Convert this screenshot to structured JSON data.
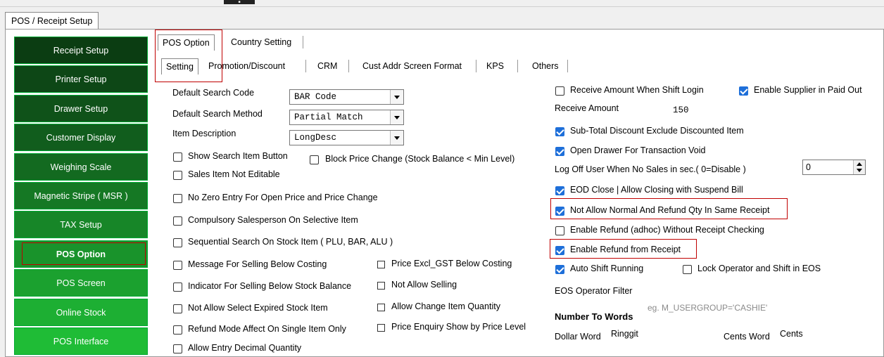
{
  "window": {
    "tab_label": "POS / Receipt Setup"
  },
  "sidebar": {
    "items": [
      {
        "label": "Receipt Setup",
        "color": "#0b3d12"
      },
      {
        "label": "Printer Setup",
        "color": "#0d4716"
      },
      {
        "label": "Drawer Setup",
        "color": "#0f5219"
      },
      {
        "label": "Customer Display",
        "color": "#115d1d"
      },
      {
        "label": "Weighing Scale",
        "color": "#136a20"
      },
      {
        "label": "Magnetic Stripe ( MSR )",
        "color": "#157824"
      },
      {
        "label": "TAX Setup",
        "color": "#178628"
      },
      {
        "label": "POS Option",
        "color": "#19932b",
        "active": true
      },
      {
        "label": "POS Screen",
        "color": "#1ba12f"
      },
      {
        "label": "Online Stock",
        "color": "#1daf33"
      },
      {
        "label": "POS Interface",
        "color": "#1fbc36"
      }
    ]
  },
  "tabs": {
    "top": [
      "POS Option",
      "Country Setting"
    ],
    "sub": [
      "Setting",
      "Promotion/Discount",
      "CRM",
      "Cust Addr Screen Format",
      "KPS",
      "Others"
    ]
  },
  "left": {
    "default_search_code_label": "Default Search Code",
    "default_search_code_value": "BAR Code",
    "default_search_method_label": "Default Search Method",
    "default_search_method_value": "Partial Match",
    "item_description_label": "Item Description",
    "item_description_value": "LongDesc",
    "checkboxes": [
      "Show Search Item Button",
      "Block Price Change (Stock Balance < Min Level)",
      "Sales Item Not Editable",
      "No Zero Entry For Open Price and Price Change",
      "Compulsory Salesperson On Selective Item",
      "Sequential Search On Stock Item ( PLU, BAR, ALU )",
      "Message For Selling Below Costing",
      "Price Excl_GST Below Costing",
      "Indicator For Selling Below Stock Balance",
      "Not Allow Selling",
      "Not Allow Select Expired Stock Item",
      "Allow Change Item Quantity",
      "Refund Mode Affect On Single Item Only",
      "Price Enquiry Show by Price Level",
      "Allow Entry Decimal Quantity"
    ]
  },
  "right": {
    "receive_amount_when_shift_login": "Receive Amount When Shift Login",
    "enable_supplier_in_paid_out": "Enable Supplier in Paid Out",
    "receive_amount_label": "Receive Amount",
    "receive_amount_value": "150",
    "subtotal_discount": "Sub-Total Discount Exclude Discounted Item",
    "open_drawer_void": "Open Drawer For Transaction Void",
    "log_off_label": "Log Off User When No Sales in sec.( 0=Disable )",
    "log_off_value": "0",
    "eod_close": "EOD Close | Allow Closing with Suspend Bill",
    "not_allow_normal_refund": "Not Allow Normal And Refund Qty In Same Receipt",
    "enable_refund_adhoc": "Enable Refund (adhoc) Without Receipt Checking",
    "enable_refund_from_receipt": "Enable Refund from Receipt",
    "auto_shift_running": "Auto Shift Running",
    "lock_operator": "Lock Operator and Shift in EOS",
    "eos_operator_filter_label": "EOS Operator Filter",
    "eos_operator_filter_value": "",
    "eos_hint": "eg. M_USERGROUP='CASHIE'",
    "number_to_words_heading": "Number To Words",
    "dollar_word_label": "Dollar Word",
    "dollar_word_value": "Ringgit",
    "cents_word_label": "Cents Word",
    "cents_word_value": "Cents"
  }
}
